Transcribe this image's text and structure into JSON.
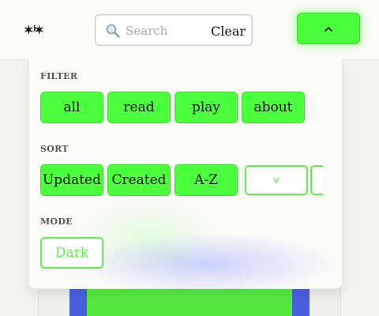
{
  "header": {
    "logo_text": "✶ʲ✶",
    "search": {
      "placeholder": "Search",
      "value": "",
      "clear_label": "Clear"
    },
    "toggle_icon": "chevron-up-icon"
  },
  "panel": {
    "filter": {
      "label": "FILTER",
      "options": [
        "all",
        "read",
        "play",
        "about"
      ]
    },
    "sort": {
      "label": "SORT",
      "options": [
        "Updated",
        "Created",
        "A-Z"
      ],
      "direction_label": "v"
    },
    "mode": {
      "label": "MODE",
      "option": "Dark"
    }
  },
  "colors": {
    "accent": "#4cff3c",
    "accent_outline": "#5cf24a",
    "background": "#f4f3ee",
    "panel": "#fbfbf8",
    "thumb_blue": "#4a5fe0"
  }
}
